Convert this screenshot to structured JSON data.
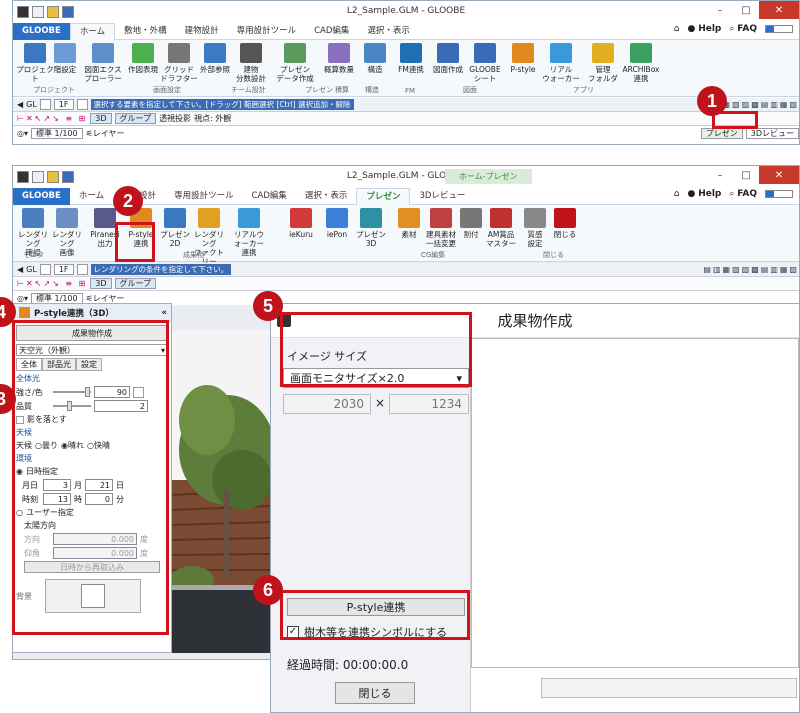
{
  "win1": {
    "title": "L2_Sample.GLM - GLOOBE",
    "tabs": [
      "GLOOBE",
      "ホーム",
      "敷地・外構",
      "建物設計",
      "専用設計ツール",
      "CAD編集",
      "選択・表示"
    ],
    "help": "Help",
    "faq": "FAQ",
    "buttons": [
      {
        "l": "プロジェクト",
        "c": "#3a78c2"
      },
      {
        "l": "階設定",
        "c": "#6a9bd6"
      },
      {
        "l": "図面エクス\nプローラー",
        "c": "#5d8fc8"
      },
      {
        "l": "作図表現",
        "c": "#4caf50"
      },
      {
        "l": "グリッド\nドラフター",
        "c": "#777"
      },
      {
        "l": "外部参照",
        "c": "#3c7bc4"
      },
      {
        "l": "建物\n分数設計",
        "c": "#555"
      },
      {
        "l": "プレゼン\nデータ作成",
        "c": "#5a9a5a"
      },
      {
        "l": "概算数量",
        "c": "#8a6fbe"
      },
      {
        "l": "構造",
        "c": "#4a86c6"
      },
      {
        "l": "FM連携",
        "c": "#1f6fb5"
      },
      {
        "l": "図面作成",
        "c": "#3a6bb8"
      },
      {
        "l": "GLOOBE\nシート",
        "c": "#3a6bb8"
      },
      {
        "l": "P-style",
        "c": "#e08a1e"
      },
      {
        "l": "リアル\nウォーカー",
        "c": "#3a9ad9"
      },
      {
        "l": "管理\nフォルダ",
        "c": "#e0b020"
      },
      {
        "l": "ARCHIBox\n連携",
        "c": "#3aa060"
      }
    ],
    "groups": [
      "プロジェクト",
      "画面設定",
      "チーム設計",
      "プレゼン",
      "積算",
      "構造",
      "FM",
      "図面",
      "アプリ"
    ],
    "hint": "選択する要素を指定して下さい。[ドラッグ] 範囲選択 [Ctrl] 選択追加・解除",
    "view_btn": "3D",
    "group_btn": "グループ",
    "persp": "透視投影",
    "viewpoint": "視点: 外観",
    "floor": "1F",
    "gl": "GL",
    "scale": "標準 1/100",
    "layer": "レイヤー",
    "present_tab": "プレゼン",
    "view3d_tab": "3Dレビュー",
    "home_tab": "Home"
  },
  "win2": {
    "title": "L2_Sample.GLM - GLOOBE",
    "context_tab": "ホーム-プレゼン",
    "tabs": [
      "GLOOBE",
      "ホーム",
      "建物設計",
      "専用設計ツール",
      "CAD編集",
      "選択・表示",
      "プレゼン",
      "3Dレビュー"
    ],
    "buttons": [
      {
        "l": "レンダリング\n確認",
        "c": "#4a7fc0"
      },
      {
        "l": "レンダリング\n画像",
        "c": "#6b8fc2"
      },
      {
        "l": "Piranesi\n出力",
        "c": "#5a5a8a"
      },
      {
        "l": "P-style\n連携",
        "c": "#e08a1e"
      },
      {
        "l": "プレゼン\n2D",
        "c": "#3a78c2"
      },
      {
        "l": "レンダリング\nファクトリー",
        "c": "#e0a020"
      },
      {
        "l": "リアルウォーカー\n連携",
        "c": "#3a9ad9"
      },
      {
        "l": "ieKuru",
        "c": "#d23a3a"
      },
      {
        "l": "iePon",
        "c": "#3a80d9"
      },
      {
        "l": "プレゼン\n3D",
        "c": "#2f8fa5"
      },
      {
        "l": "素材",
        "c": "#e09020"
      },
      {
        "l": "建具素材\n一括変更",
        "c": "#c04040"
      },
      {
        "l": "割付",
        "c": "#777"
      },
      {
        "l": "AM賞品\nマスター",
        "c": "#c03030"
      },
      {
        "l": "質感\n設定",
        "c": "#888"
      },
      {
        "l": "閉じる",
        "c": "#c0121a"
      }
    ],
    "groups": [
      "モニタ",
      "成果物",
      "CG編集",
      "閉じる"
    ],
    "hint": "レンダリングの条件を指定して下さい。"
  },
  "panel": {
    "title": "P-style連携（3D）",
    "create_btn": "成果物作成",
    "sky": "天空光（外観）",
    "tabs": [
      "全体",
      "部品光",
      "設定"
    ],
    "sec_all": "全体光",
    "strength": "強さ/色",
    "strength_val": "90",
    "quality": "品質",
    "quality_val": "2",
    "shadow": "影を落とす",
    "sec_weather": "天候",
    "weather": "天候",
    "weather_opts": [
      "曇り",
      "晴れ",
      "快晴"
    ],
    "sec_env": "環境",
    "datetime": "日時指定",
    "month_l": "月日",
    "month": "3",
    "day": "21",
    "month_u": "月",
    "day_u": "日",
    "time_l": "時刻",
    "hour": "13",
    "minute": "0",
    "hour_u": "時",
    "minute_u": "分",
    "user": "ユーザー指定",
    "sun": "太陽方向",
    "dir": "方向",
    "dir_val": "0.000",
    "dir_u": "度",
    "elev": "仰角",
    "elev_val": "0.000",
    "elev_u": "度",
    "recalc": "日時から再取込み",
    "bg": "背景"
  },
  "dialog": {
    "title": "成果物作成",
    "size_label": "イメージ サイズ",
    "size_sel": "画面モニタサイズ×2.0",
    "width": "2030",
    "times": "×",
    "height": "1234",
    "pstyle_btn": "P-style連携",
    "tree_chk": "樹木等を連携シンボルにする",
    "elapsed": "経過時間: 00:00:00.0",
    "close": "閉じる"
  },
  "badges": [
    "1",
    "2",
    "3",
    "4",
    "5",
    "6"
  ]
}
